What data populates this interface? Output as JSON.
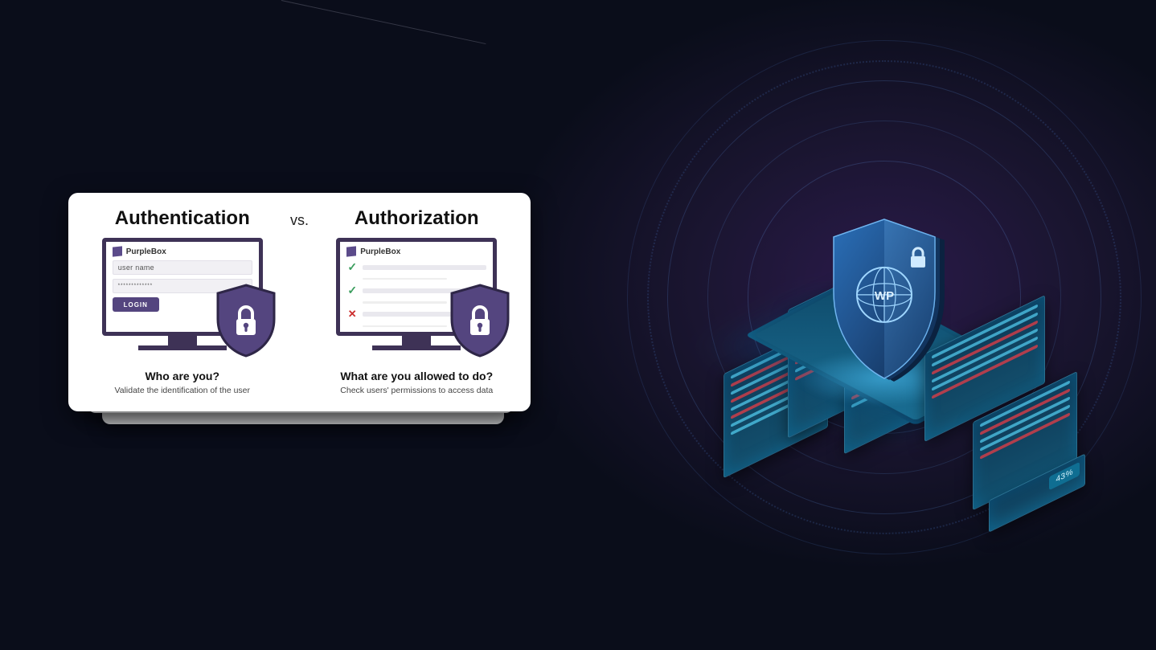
{
  "card": {
    "left": {
      "title": "Authentication",
      "brand": "PurpleBox",
      "username_placeholder": "user name",
      "password_mask": "*************",
      "login_label": "LOGIN",
      "question": "Who are you?",
      "desc": "Validate the identification of the user"
    },
    "vs_label": "vs.",
    "right": {
      "title": "Authorization",
      "brand": "PurpleBox",
      "checks": [
        "ok",
        "ok",
        "no"
      ],
      "question": "What are you allowed to do?",
      "desc": "Check users' permissions to access data"
    }
  },
  "hero": {
    "badge_text": "43%",
    "shield_text": "WP"
  },
  "colors": {
    "purple": "#54457f",
    "monitor": "#3e3256",
    "ok": "#3a9d5d",
    "no": "#cc2e2e"
  }
}
